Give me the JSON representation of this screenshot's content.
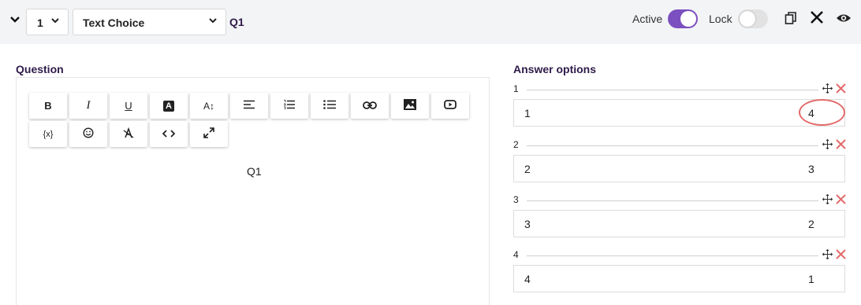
{
  "header": {
    "question_number": "1",
    "question_type": "Text Choice",
    "question_name": "Q1",
    "active_label": "Active",
    "active_on": true,
    "lock_label": "Lock",
    "lock_on": false
  },
  "question_section": {
    "title": "Question",
    "toolbar_labels": {
      "bold": "B",
      "italic": "I",
      "underline": "U",
      "text_color": "A",
      "font_size": "A↕",
      "variable": "{x}"
    },
    "toolbar_icons": [
      "align-left-icon",
      "ordered-list-icon",
      "unordered-list-icon",
      "link-icon",
      "image-icon",
      "video-icon",
      "emoji-icon",
      "clear-format-icon",
      "code-icon",
      "fullscreen-icon"
    ],
    "content": "Q1"
  },
  "answer_section": {
    "title": "Answer options",
    "options": [
      {
        "index": "1",
        "text": "1",
        "value": "4"
      },
      {
        "index": "2",
        "text": "2",
        "value": "3"
      },
      {
        "index": "3",
        "text": "3",
        "value": "2"
      },
      {
        "index": "4",
        "text": "4",
        "value": "1"
      }
    ]
  },
  "colors": {
    "accent": "#7b4fbf",
    "heading": "#2f1b49",
    "delete": "#e46a6a",
    "header_bg": "#f3f4f6"
  }
}
